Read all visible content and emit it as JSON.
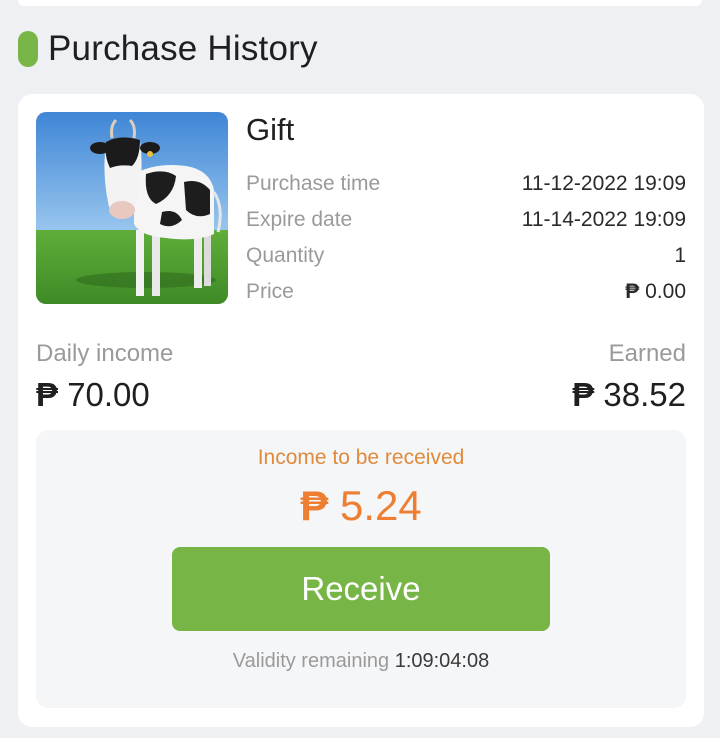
{
  "header": {
    "title": "Purchase History"
  },
  "order": {
    "product_name": "Gift",
    "image_subject": "dairy cow on grass field",
    "details": [
      {
        "label": "Purchase time",
        "value": "11-12-2022 19:09"
      },
      {
        "label": "Expire date",
        "value": "11-14-2022 19:09"
      },
      {
        "label": "Quantity",
        "value": "1"
      },
      {
        "label": "Price",
        "currency": "₱",
        "value": "0.00"
      }
    ],
    "daily_income": {
      "label": "Daily income",
      "currency": "₱",
      "value": "70.00"
    },
    "earned": {
      "label": "Earned",
      "currency": "₱",
      "value": "38.52"
    },
    "pending": {
      "label": "Income to be received",
      "currency": "₱",
      "value": "5.24",
      "button_label": "Receive",
      "validity_label": "Validity remaining",
      "validity_value": "1:09:04:08"
    }
  },
  "colors": {
    "accent_green": "#78b547",
    "accent_orange": "#ee7f32",
    "background": "#eef0f4",
    "card": "#ffffff"
  }
}
